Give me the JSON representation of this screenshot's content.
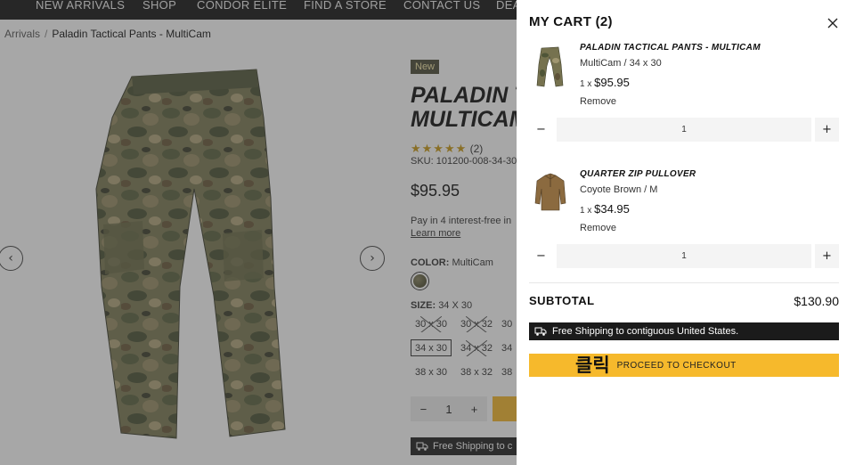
{
  "topnav": {
    "items": [
      "NEW ARRIVALS",
      "SHOP",
      "CONDOR ELITE",
      "FIND A STORE",
      "CONTACT US",
      "DEA"
    ]
  },
  "breadcrumb": {
    "parent": "Arrivals",
    "separator": "/",
    "current": "Paladin Tactical Pants - MultiCam"
  },
  "product": {
    "badge": "New",
    "title_line1": "PALADIN T",
    "title_line2": "MULTICAM",
    "stars": "★★★★★",
    "review_count": "(2)",
    "sku": "SKU: 101200-008-34-30",
    "price": "$95.95",
    "pay_text": "Pay in 4 interest-free in",
    "learn_more": "Learn more",
    "color_label": "COLOR:",
    "color_value": "MultiCam",
    "size_label": "SIZE:",
    "size_value": "34 X 30",
    "sizes": [
      "30 x 30",
      "30 x 32",
      "30",
      "34 x 30",
      "34 x 32",
      "34",
      "38 x 30",
      "38 x 32",
      "38"
    ],
    "qty_minus": "−",
    "qty_value": "1",
    "qty_plus": "+",
    "shipping_text": "Free Shipping to c"
  },
  "carousel": {
    "prev_icon": "‹",
    "next_icon": "›"
  },
  "cart": {
    "title": "MY CART (2)",
    "items": [
      {
        "name": "PALADIN TACTICAL PANTS - MULTICAM",
        "variant": "MultiCam / 34 x 30",
        "qty_prefix": "1 x",
        "price": "$95.95",
        "remove": "Remove",
        "qty": "1"
      },
      {
        "name": "QUARTER ZIP PULLOVER",
        "variant": "Coyote Brown / M",
        "qty_prefix": "1 x",
        "price": "$34.95",
        "remove": "Remove",
        "qty": "1"
      }
    ],
    "qty_minus": "−",
    "qty_plus": "+",
    "subtotal_label": "SUBTOTAL",
    "subtotal_value": "$130.90",
    "shipping_text": "Free Shipping to contiguous United States.",
    "checkout_korean": "클릭",
    "checkout_label": "PROCEED TO CHECKOUT"
  },
  "colors": {
    "accent": "#f6b92c",
    "nav_bg": "#161616",
    "star": "#c99a16",
    "badge_bg": "#4d4d3a"
  }
}
